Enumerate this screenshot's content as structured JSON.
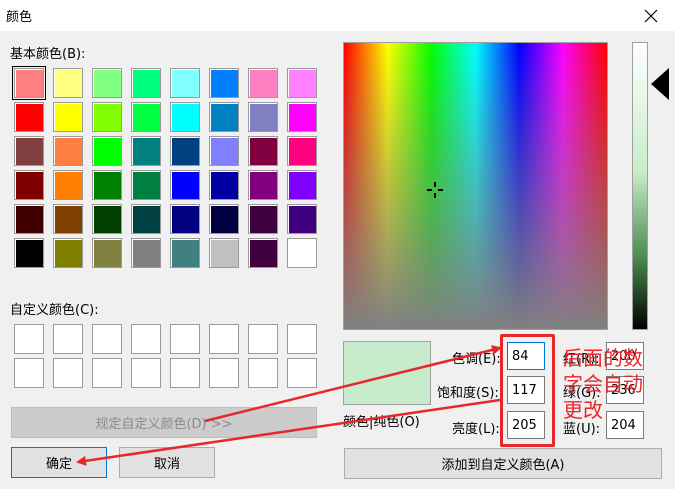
{
  "window": {
    "title": "颜色",
    "close_icon": "close-icon"
  },
  "basic": {
    "label": "基本颜色(B):",
    "colors": [
      "#ff8080",
      "#ffff80",
      "#80ff80",
      "#00ff80",
      "#80ffff",
      "#0080ff",
      "#ff80c0",
      "#ff80ff",
      "#ff0000",
      "#ffff00",
      "#80ff00",
      "#00ff40",
      "#00ffff",
      "#0080c0",
      "#8080c0",
      "#ff00ff",
      "#804040",
      "#ff8040",
      "#00ff00",
      "#008080",
      "#004080",
      "#8080ff",
      "#800040",
      "#ff0080",
      "#800000",
      "#ff8000",
      "#008000",
      "#008040",
      "#0000ff",
      "#0000a0",
      "#800080",
      "#8000ff",
      "#400000",
      "#804000",
      "#004000",
      "#004040",
      "#000080",
      "#000040",
      "#400040",
      "#400080",
      "#000000",
      "#808000",
      "#808040",
      "#808080",
      "#408080",
      "#c0c0c0",
      "#400040",
      "#ffffff"
    ],
    "selected_index": 0
  },
  "custom": {
    "label": "自定义颜色(C):",
    "count": 16
  },
  "buttons": {
    "define_custom": "规定自定义颜色(D) >>",
    "ok": "确定",
    "cancel": "取消",
    "add_custom": "添加到自定义颜色(A)"
  },
  "preview": {
    "label": "颜色|纯色(O)",
    "color": "#c7ebcb"
  },
  "fields": {
    "hue_label": "色调(E):",
    "hue_value": "84",
    "sat_label": "饱和度(S):",
    "sat_value": "117",
    "lum_label": "亮度(L):",
    "lum_value": "205",
    "red_label": "红(R):",
    "red_value": "200",
    "green_label": "绿(G):",
    "green_value": "236",
    "blue_label": "蓝(U):",
    "blue_value": "204"
  },
  "annotation": {
    "text": "后面的数字会自动更改",
    "line1": "后面的数",
    "line2": "字会自动",
    "line3": "更改",
    "color": "#e8272a"
  }
}
